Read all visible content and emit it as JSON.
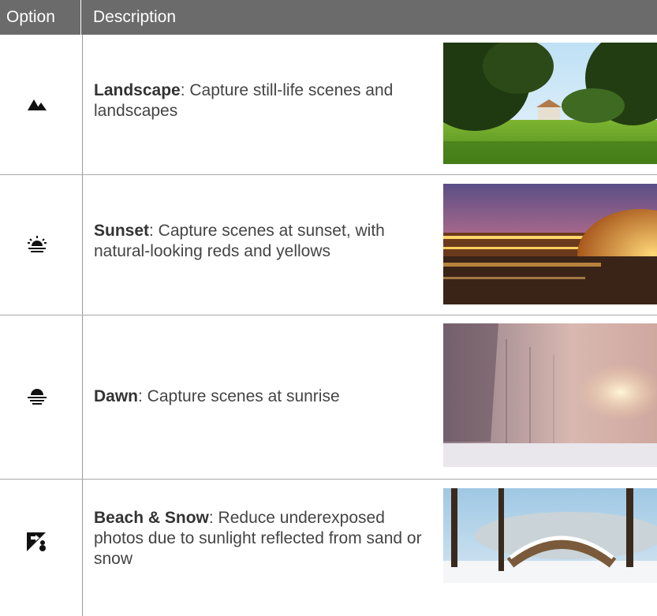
{
  "header": {
    "option_label": "Option",
    "description_label": "Description"
  },
  "rows": [
    {
      "icon": "landscape-mode-icon",
      "title": "Landscape",
      "description": ": Capture still-life scenes and landscapes",
      "photo": "park-landscape-photo"
    },
    {
      "icon": "sunset-mode-icon",
      "title": "Sunset",
      "description": ": Capture scenes at sunset, with natural-looking reds and yellows",
      "photo": "sunset-building-photo"
    },
    {
      "icon": "dawn-mode-icon",
      "title": "Dawn",
      "description": ": Capture scenes at sunrise",
      "photo": "foggy-sunrise-photo"
    },
    {
      "icon": "beach-snow-mode-icon",
      "title": "Beach & Snow",
      "description": ": Reduce underexposed photos due to sunlight reflected from sand or snow",
      "photo": "snowy-park-photo"
    }
  ],
  "colors": {
    "header_bg": "#6b6b6b",
    "rule": "#a8a8a8",
    "text": "#444444"
  }
}
